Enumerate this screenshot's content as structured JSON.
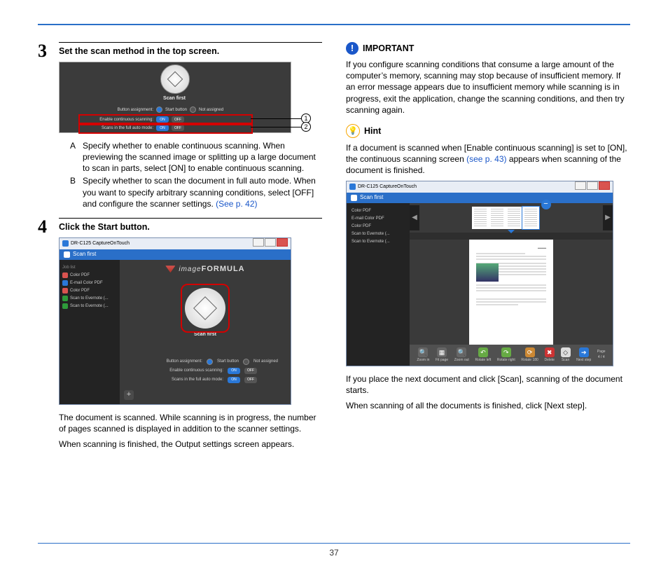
{
  "page_number": "37",
  "left": {
    "step3": {
      "num": "3",
      "title": "Set the scan method in the top screen.",
      "callout1_num": "1",
      "callout2_num": "2",
      "screenshot": {
        "scan_first": "Scan first",
        "row_assign_label": "Button assignment:",
        "row_assign_opt1": "Start button",
        "row_assign_opt2": "Not assigned",
        "row_cont_label": "Enable continuous scanning:",
        "row_auto_label": "Scans in the full auto mode:",
        "on": "ON",
        "off": "OFF"
      },
      "item1_num": "A",
      "item1_text": "Specify whether to enable continuous scanning. When previewing the scanned image or splitting up a large document to scan in parts, select [ON] to enable continuous scanning.",
      "item2_num": "B",
      "item2_text_a": "Specify whether to scan the document in full auto mode. When you want to specify arbitrary scanning conditions, select [OFF] and configure the scanner settings. ",
      "item2_link": "(See p. 42)"
    },
    "step4": {
      "num": "4",
      "title": "Click the Start button.",
      "screenshot": {
        "window_title": "DR-C125 CaptureOnTouch",
        "sidebar_header": "Scan first",
        "sidebar_group": "Job list",
        "items": {
          "a": "Color PDF",
          "b": "E-mail Color PDF",
          "c": "Color PDF",
          "d": "Scan to Evernote (...",
          "e": "Scan to Evernote (..."
        },
        "brand_a": "image",
        "brand_b": "FORMULA",
        "scan_first": "Scan first",
        "row_assign_label": "Button assignment:",
        "row_assign_opt1": "Start button",
        "row_assign_opt2": "Not assigned",
        "row_cont_label": "Enable continuous scanning:",
        "row_auto_label": "Scans in the full auto mode:",
        "on": "ON",
        "off": "OFF",
        "plus": "+"
      },
      "para1": "The document is scanned. While scanning is in progress, the number of pages scanned is displayed in addition to the scanner settings.",
      "para2": "When scanning is finished, the Output settings screen appears."
    }
  },
  "right": {
    "important": {
      "label": "IMPORTANT",
      "text": "If you configure scanning conditions that consume a large amount of the computer’s memory, scanning may stop because of insufficient memory. If an error message appears due to insufficient memory while scanning is in progress, exit the application, change the scanning conditions, and then try scanning again."
    },
    "hint": {
      "label": "Hint",
      "text_a": "If a document is scanned when [Enable continuous scanning] is set to [ON], the continuous scanning screen ",
      "link": "(see p. 43)",
      "text_b": " appears when scanning of the document is finished."
    },
    "screenshot": {
      "window_title": "DR-C125 CaptureOnTouch",
      "sidebar_header": "Scan first",
      "items": {
        "a": "Color PDF",
        "b": "E-mail Color PDF",
        "c": "Color PDF",
        "d": "Scan to Evernote (...",
        "e": "Scan to Evernote (..."
      },
      "toolbar": {
        "zoom_in": "Zoom in",
        "fit_page": "Fit page",
        "zoom_out": "Zoom out",
        "rotate_left": "Rotate left",
        "rotate_right": "Rotate right",
        "rotate_180": "Rotate 180",
        "delete": "Delete",
        "scan": "Scan",
        "next_step": "Next step",
        "page_label": "Page",
        "page_value": "4 / 4"
      }
    },
    "para1": "If you place the next document and click [Scan], scanning of the document starts.",
    "para2": "When scanning of all the documents is finished, click [Next step]."
  }
}
